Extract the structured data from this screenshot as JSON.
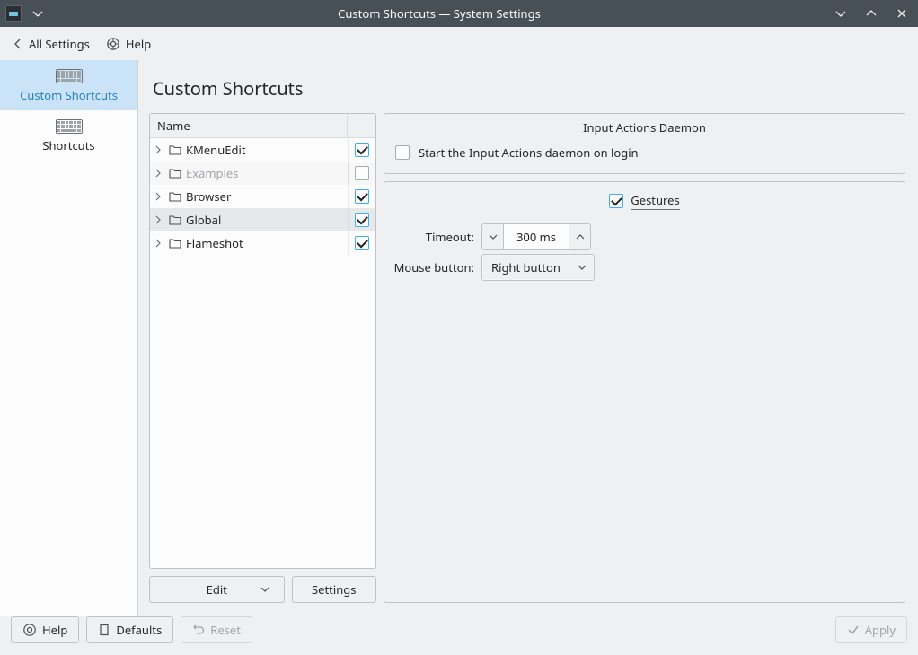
{
  "window": {
    "title": "Custom Shortcuts — System Settings"
  },
  "toolbar": {
    "all_settings": "All Settings",
    "help": "Help"
  },
  "sidebar": {
    "items": [
      {
        "label": "Custom Shortcuts",
        "selected": true
      },
      {
        "label": "Shortcuts",
        "selected": false
      }
    ]
  },
  "page": {
    "heading": "Custom Shortcuts"
  },
  "tree": {
    "header": "Name",
    "rows": [
      {
        "label": "KMenuEdit",
        "checked": true,
        "selected": false,
        "dim": false
      },
      {
        "label": "Examples",
        "checked": false,
        "selected": false,
        "dim": true
      },
      {
        "label": "Browser",
        "checked": true,
        "selected": false,
        "dim": false
      },
      {
        "label": "Global",
        "checked": true,
        "selected": true,
        "dim": false
      },
      {
        "label": "Flameshot",
        "checked": true,
        "selected": false,
        "dim": false
      }
    ]
  },
  "left_buttons": {
    "edit": "Edit",
    "settings": "Settings"
  },
  "daemon": {
    "group_title": "Input Actions Daemon",
    "start_label": "Start the Input Actions daemon on login",
    "start_checked": false
  },
  "gestures": {
    "title": "Gestures",
    "enabled": true,
    "timeout_label": "Timeout:",
    "timeout_value": "300 ms",
    "mouse_label": "Mouse button:",
    "mouse_value": "Right button"
  },
  "footer": {
    "help": "Help",
    "defaults": "Defaults",
    "reset": "Reset",
    "apply": "Apply"
  }
}
